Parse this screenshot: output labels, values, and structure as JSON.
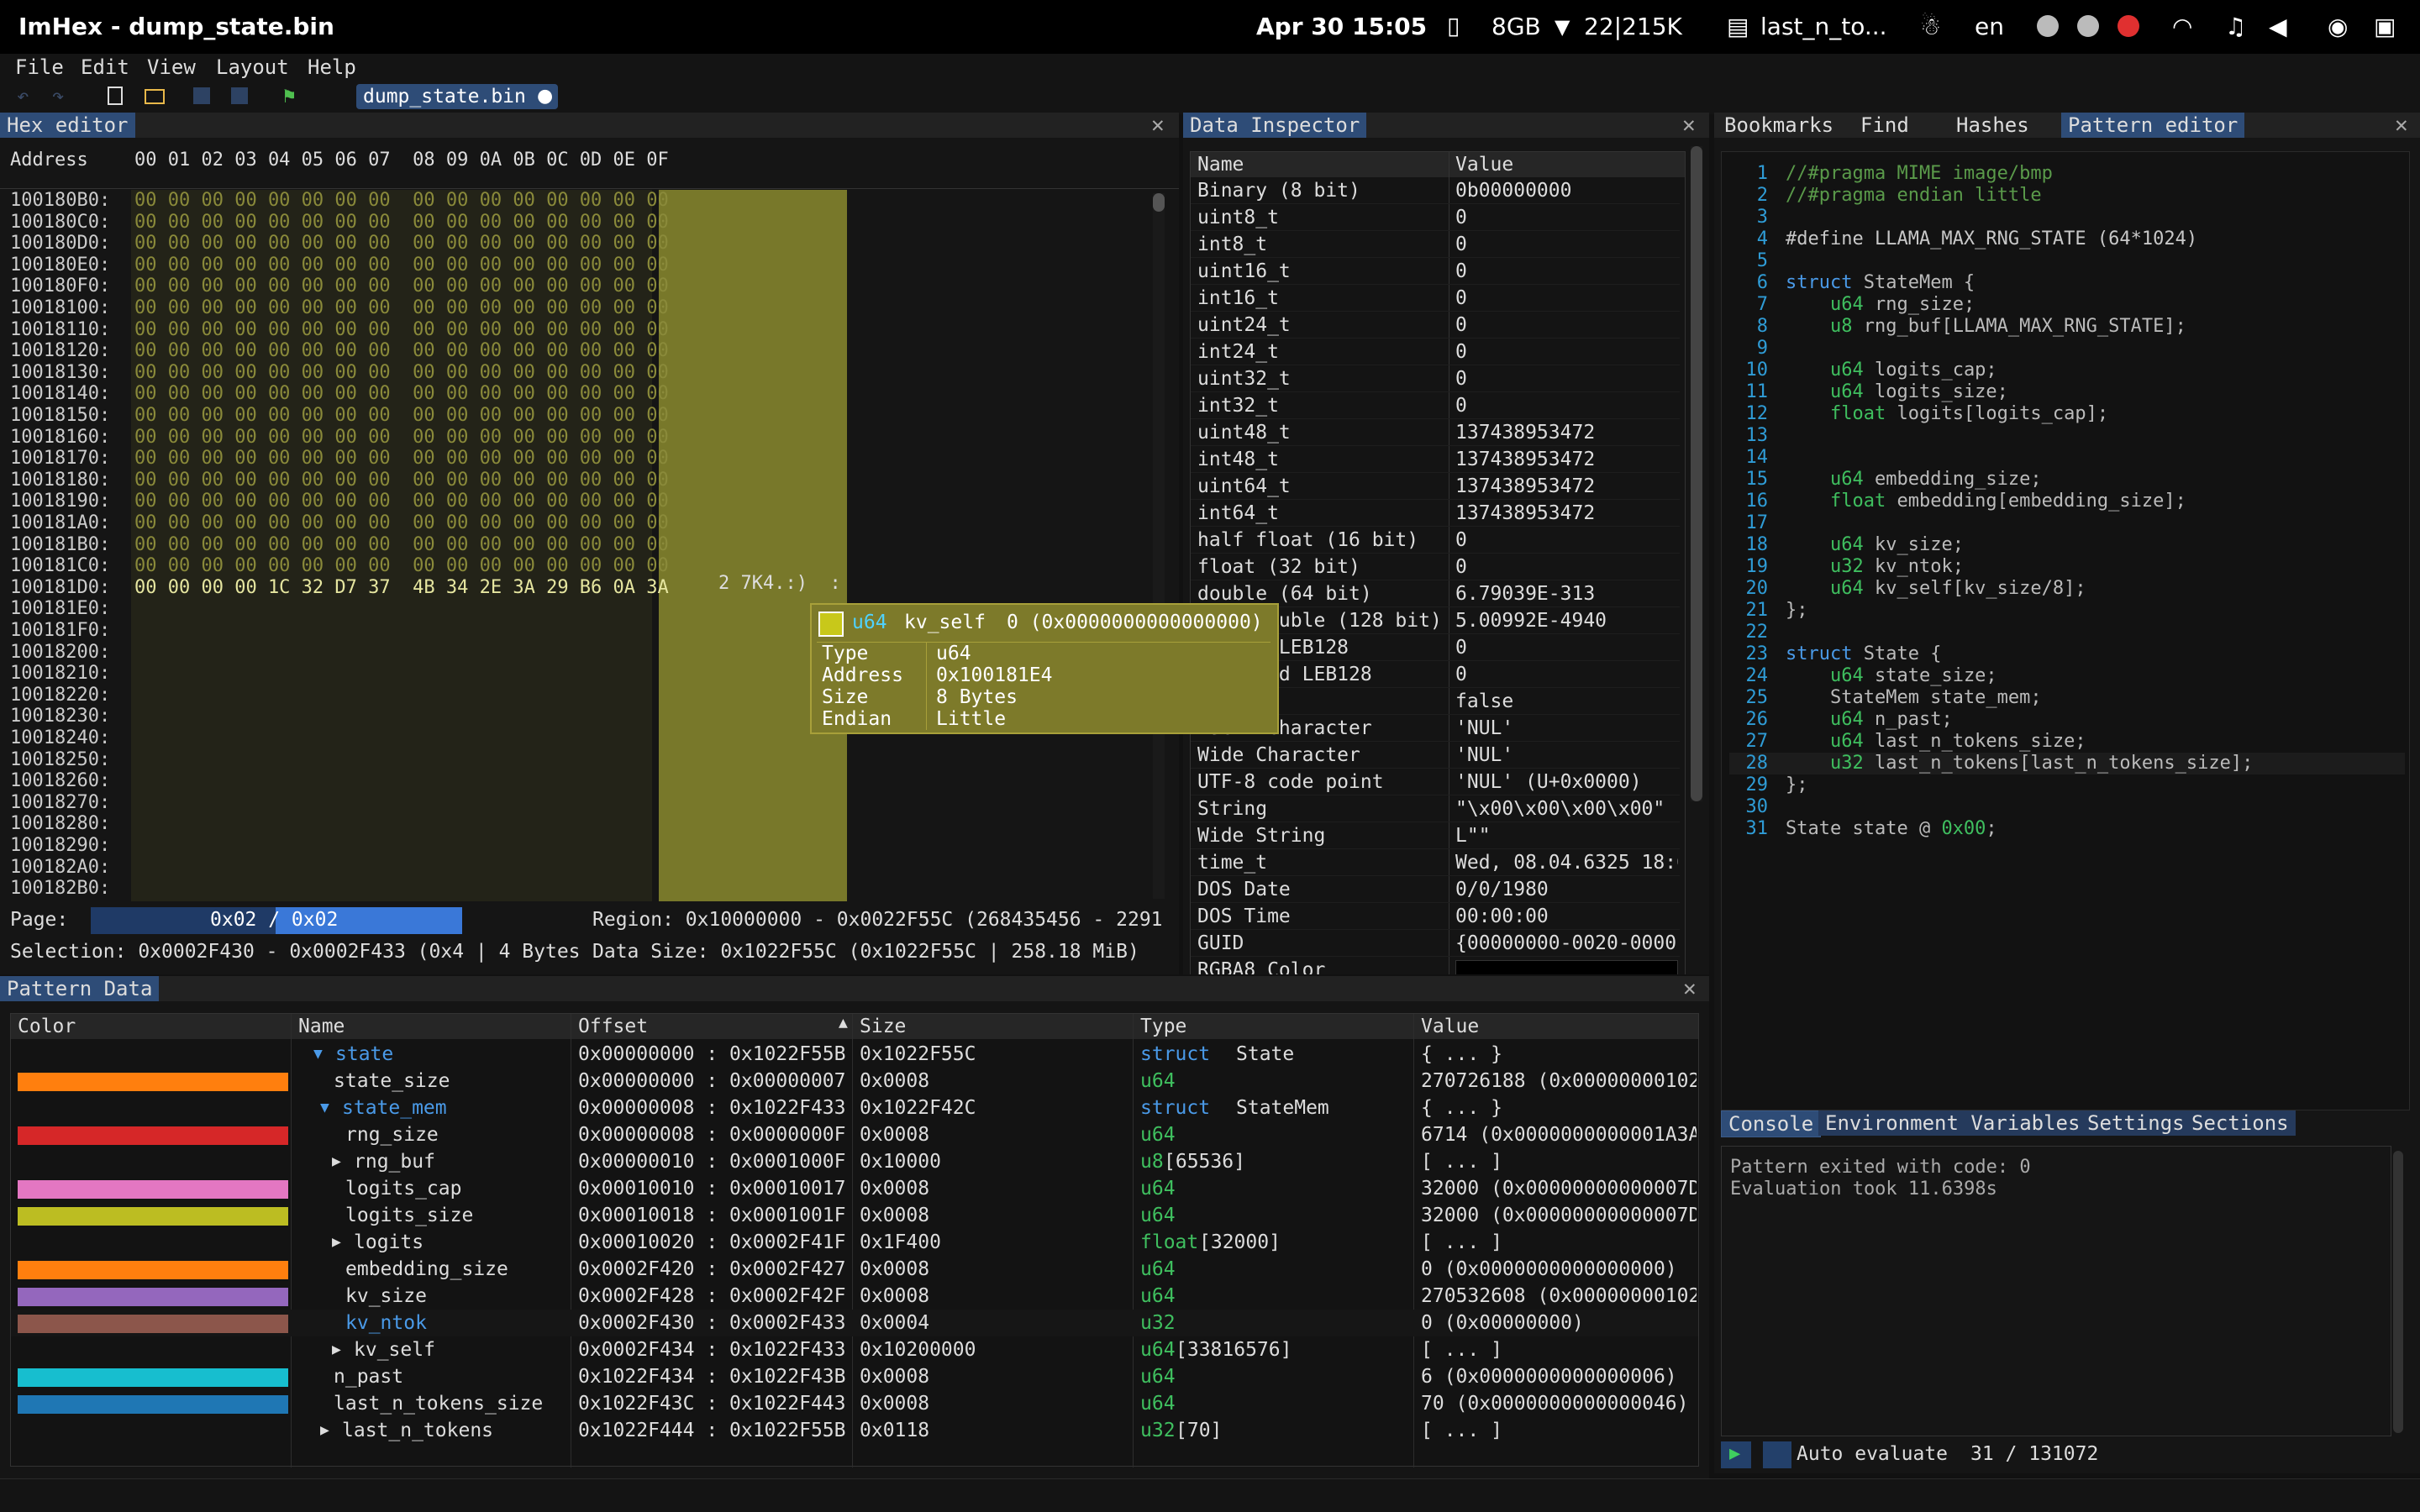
{
  "system_bar": {
    "app_title": "ImHex - dump_state.bin",
    "datetime": "Apr 30  15:05",
    "memory": "8GB",
    "network": "22|215K",
    "clipboard": "last_n_to...",
    "language": "en"
  },
  "menu": [
    "File",
    "Edit",
    "View",
    "Layout",
    "Help"
  ],
  "open_file_tab": "dump_state.bin",
  "hex_editor": {
    "title": "Hex editor",
    "address_header": "Address",
    "columns_header": "00 01 02 03 04 05 06 07  08 09 0A 0B 0C 0D 0E 0F",
    "rows": [
      {
        "addr": "100180B0:",
        "bytes": "00 00 00 00 00 00 00 00  00 00 00 00 00 00 00 00"
      },
      {
        "addr": "100180C0:",
        "bytes": "00 00 00 00 00 00 00 00  00 00 00 00 00 00 00 00"
      },
      {
        "addr": "100180D0:",
        "bytes": "00 00 00 00 00 00 00 00  00 00 00 00 00 00 00 00"
      },
      {
        "addr": "100180E0:",
        "bytes": "00 00 00 00 00 00 00 00  00 00 00 00 00 00 00 00"
      },
      {
        "addr": "100180F0:",
        "bytes": "00 00 00 00 00 00 00 00  00 00 00 00 00 00 00 00"
      },
      {
        "addr": "10018100:",
        "bytes": "00 00 00 00 00 00 00 00  00 00 00 00 00 00 00 00"
      },
      {
        "addr": "10018110:",
        "bytes": "00 00 00 00 00 00 00 00  00 00 00 00 00 00 00 00"
      },
      {
        "addr": "10018120:",
        "bytes": "00 00 00 00 00 00 00 00  00 00 00 00 00 00 00 00"
      },
      {
        "addr": "10018130:",
        "bytes": "00 00 00 00 00 00 00 00  00 00 00 00 00 00 00 00"
      },
      {
        "addr": "10018140:",
        "bytes": "00 00 00 00 00 00 00 00  00 00 00 00 00 00 00 00"
      },
      {
        "addr": "10018150:",
        "bytes": "00 00 00 00 00 00 00 00  00 00 00 00 00 00 00 00"
      },
      {
        "addr": "10018160:",
        "bytes": "00 00 00 00 00 00 00 00  00 00 00 00 00 00 00 00"
      },
      {
        "addr": "10018170:",
        "bytes": "00 00 00 00 00 00 00 00  00 00 00 00 00 00 00 00"
      },
      {
        "addr": "10018180:",
        "bytes": "00 00 00 00 00 00 00 00  00 00 00 00 00 00 00 00"
      },
      {
        "addr": "10018190:",
        "bytes": "00 00 00 00 00 00 00 00  00 00 00 00 00 00 00 00"
      },
      {
        "addr": "100181A0:",
        "bytes": "00 00 00 00 00 00 00 00  00 00 00 00 00 00 00 00"
      },
      {
        "addr": "100181B0:",
        "bytes": "00 00 00 00 00 00 00 00  00 00 00 00 00 00 00 00"
      },
      {
        "addr": "100181C0:",
        "bytes": "00 00 00 00 00 00 00 00  00 00 00 00 00 00 00 00"
      },
      {
        "addr": "100181D0:",
        "bytes": "00 00 00 00 1C 32 D7 37  4B 34 2E 3A 29 B6 0A 3A"
      },
      {
        "addr": "100181E0:",
        "bytes": ""
      },
      {
        "addr": "100181F0:",
        "bytes": ""
      },
      {
        "addr": "10018200:",
        "bytes": ""
      },
      {
        "addr": "10018210:",
        "bytes": ""
      },
      {
        "addr": "10018220:",
        "bytes": ""
      },
      {
        "addr": "10018230:",
        "bytes": ""
      },
      {
        "addr": "10018240:",
        "bytes": ""
      },
      {
        "addr": "10018250:",
        "bytes": ""
      },
      {
        "addr": "10018260:",
        "bytes": ""
      },
      {
        "addr": "10018270:",
        "bytes": ""
      },
      {
        "addr": "10018280:",
        "bytes": ""
      },
      {
        "addr": "10018290:",
        "bytes": ""
      },
      {
        "addr": "100182A0:",
        "bytes": ""
      },
      {
        "addr": "100182B0:",
        "bytes": ""
      }
    ],
    "ascii_snippet": "2 7K4.:)  :",
    "page_label": "Page:",
    "page_value": "0x02 / 0x02",
    "region": "Region: 0x10000000 - 0x0022F55C (268435456 - 2291",
    "selection": "Selection: 0x0002F430 - 0x0002F433 (0x4 | 4 Bytes",
    "data_size": "Data Size: 0x1022F55C (0x1022F55C | 258.18 MiB)"
  },
  "tooltip": {
    "type_kw": "u64",
    "name": "kv_self",
    "index": "0 (0x0000000000000000)",
    "rows": [
      {
        "k": "Type",
        "v": "u64"
      },
      {
        "k": "Address",
        "v": "0x100181E4"
      },
      {
        "k": "Size",
        "v": "8 Bytes"
      },
      {
        "k": "Endian",
        "v": "Little"
      }
    ]
  },
  "data_inspector": {
    "title": "Data Inspector",
    "col_name": "Name",
    "col_value": "Value",
    "rows": [
      {
        "n": "Binary (8 bit)",
        "v": "0b00000000"
      },
      {
        "n": "uint8_t",
        "v": "0"
      },
      {
        "n": "int8_t",
        "v": "0"
      },
      {
        "n": "uint16_t",
        "v": "0"
      },
      {
        "n": "int16_t",
        "v": "0"
      },
      {
        "n": "uint24_t",
        "v": "0"
      },
      {
        "n": "int24_t",
        "v": "0"
      },
      {
        "n": "uint32_t",
        "v": "0"
      },
      {
        "n": "int32_t",
        "v": "0"
      },
      {
        "n": "uint48_t",
        "v": "137438953472"
      },
      {
        "n": "int48_t",
        "v": "137438953472"
      },
      {
        "n": "uint64_t",
        "v": "137438953472"
      },
      {
        "n": "int64_t",
        "v": "137438953472"
      },
      {
        "n": "half float (16 bit)",
        "v": "0"
      },
      {
        "n": "float (32 bit)",
        "v": "0"
      },
      {
        "n": "double (64 bit)",
        "v": "6.79039E-313"
      },
      {
        "n": "long double (128 bit)",
        "v": "5.00992E-4940"
      },
      {
        "n": "Signed LEB128",
        "v": "0"
      },
      {
        "n": "Unsigned LEB128",
        "v": "0"
      },
      {
        "n": "bool",
        "v": "false"
      },
      {
        "n": "ASCII Character",
        "v": "'NUL'"
      },
      {
        "n": "Wide Character",
        "v": "'NUL'"
      },
      {
        "n": "UTF-8 code point",
        "v": "'NUL' (U+0x0000)"
      },
      {
        "n": "String",
        "v": "\"\\x00\\x00\\x00\\x00\""
      },
      {
        "n": "Wide String",
        "v": "L\"\""
      },
      {
        "n": "time_t",
        "v": "Wed, 08.04.6325 18:0"
      },
      {
        "n": "DOS Date",
        "v": "0/0/1980"
      },
      {
        "n": "DOS Time",
        "v": "00:00:00"
      },
      {
        "n": "GUID",
        "v": "{00000000-0020-0000-"
      },
      {
        "n": "RGBA8 Color",
        "v": ""
      }
    ]
  },
  "right_tabs": [
    "Bookmarks",
    "Find",
    "Hashes",
    "Pattern editor"
  ],
  "pattern_code": [
    "//#pragma MIME image/bmp",
    "//#pragma endian little",
    "",
    "#define LLAMA_MAX_RNG_STATE (64*1024)",
    "",
    "struct StateMem {",
    "    u64 rng_size;",
    "    u8 rng_buf[LLAMA_MAX_RNG_STATE];",
    "",
    "    u64 logits_cap;",
    "    u64 logits_size;",
    "    float logits[logits_cap];",
    "",
    "",
    "    u64 embedding_size;",
    "    float embedding[embedding_size];",
    "",
    "    u64 kv_size;",
    "    u32 kv_ntok;",
    "    u64 kv_self[kv_size/8];",
    "};",
    "",
    "struct State {",
    "    u64 state_size;",
    "    StateMem state_mem;",
    "    u64 n_past;",
    "    u64 last_n_tokens_size;",
    "    u32 last_n_tokens[last_n_tokens_size];",
    "};",
    "",
    "State state @ 0x00;"
  ],
  "console_tabs": [
    "Console",
    "Environment Variables",
    "Settings",
    "Sections"
  ],
  "console_lines": [
    "Pattern exited with code: 0",
    "Evaluation took 11.6398s"
  ],
  "auto_evaluate": "Auto evaluate",
  "line_status": "31 / 131072",
  "pattern_data": {
    "title": "Pattern Data",
    "headers": [
      "Color",
      "Name",
      "Offset",
      "Size",
      "Type",
      "Value"
    ],
    "rows": [
      {
        "color": "",
        "name": "state",
        "exp": "▼",
        "offset": "0x00000000 : 0x1022F55B",
        "size": "0x1022F55C",
        "tk": "struct",
        "tn": "State",
        "value": "{ ... }",
        "indent": 0
      },
      {
        "color": "#ff7f0e",
        "name": "state_size",
        "exp": "",
        "offset": "0x00000000 : 0x00000007",
        "size": "0x0008",
        "tk": "u64",
        "tn": "",
        "value": "270726188 (0x00000000102",
        "indent": 1
      },
      {
        "color": "",
        "name": "state_mem",
        "exp": "▼",
        "offset": "0x00000008 : 0x1022F433",
        "size": "0x1022F42C",
        "tk": "struct",
        "tn": "StateMem",
        "value": "{ ... }",
        "indent": 1
      },
      {
        "color": "#d62728",
        "name": "rng_size",
        "exp": "",
        "offset": "0x00000008 : 0x0000000F",
        "size": "0x0008",
        "tk": "u64",
        "tn": "",
        "value": "6714 (0x0000000000001A3A",
        "indent": 2
      },
      {
        "color": "",
        "name": "rng_buf",
        "exp": "▶",
        "offset": "0x00000010 : 0x0001000F",
        "size": "0x10000",
        "tk": "u8",
        "tn": "[65536]",
        "value": "[ ... ]",
        "indent": 2
      },
      {
        "color": "#e377c2",
        "name": "logits_cap",
        "exp": "",
        "offset": "0x00010010 : 0x00010017",
        "size": "0x0008",
        "tk": "u64",
        "tn": "",
        "value": "32000 (0x00000000000007D0",
        "indent": 2
      },
      {
        "color": "#bcbd22",
        "name": "logits_size",
        "exp": "",
        "offset": "0x00010018 : 0x0001001F",
        "size": "0x0008",
        "tk": "u64",
        "tn": "",
        "value": "32000 (0x00000000000007D0",
        "indent": 2
      },
      {
        "color": "",
        "name": "logits",
        "exp": "▶",
        "offset": "0x00010020 : 0x0002F41F",
        "size": "0x1F400",
        "tk": "float",
        "tn": "[32000]",
        "value": "[ ... ]",
        "indent": 2
      },
      {
        "color": "#ff7f0e",
        "name": "embedding_size",
        "exp": "",
        "offset": "0x0002F420 : 0x0002F427",
        "size": "0x0008",
        "tk": "u64",
        "tn": "",
        "value": "0 (0x0000000000000000)",
        "indent": 2
      },
      {
        "color": "#9467bd",
        "name": "kv_size",
        "exp": "",
        "offset": "0x0002F428 : 0x0002F42F",
        "size": "0x0008",
        "tk": "u64",
        "tn": "",
        "value": "270532608 (0x00000000102",
        "indent": 2
      },
      {
        "color": "#8c564b",
        "name": "kv_ntok",
        "exp": "",
        "offset": "0x0002F430 : 0x0002F433",
        "size": "0x0004",
        "tk": "u32",
        "tn": "",
        "value": "0 (0x00000000)",
        "indent": 2,
        "highlight": true
      },
      {
        "color": "",
        "name": "kv_self",
        "exp": "▶",
        "offset": "0x0002F434 : 0x1022F433",
        "size": "0x10200000",
        "tk": "u64",
        "tn": "[33816576]",
        "value": "[ ... ]",
        "indent": 2
      },
      {
        "color": "#17becf",
        "name": "n_past",
        "exp": "",
        "offset": "0x1022F434 : 0x1022F43B",
        "size": "0x0008",
        "tk": "u64",
        "tn": "",
        "value": "6 (0x0000000000000006)",
        "indent": 1
      },
      {
        "color": "#1f77b4",
        "name": "last_n_tokens_size",
        "exp": "",
        "offset": "0x1022F43C : 0x1022F443",
        "size": "0x0008",
        "tk": "u64",
        "tn": "",
        "value": "70 (0x0000000000000046)",
        "indent": 1
      },
      {
        "color": "",
        "name": "last_n_tokens",
        "exp": "▶",
        "offset": "0x1022F444 : 0x1022F55B",
        "size": "0x0118",
        "tk": "u32",
        "tn": "[70]",
        "value": "[ ... ]",
        "indent": 1
      }
    ]
  }
}
